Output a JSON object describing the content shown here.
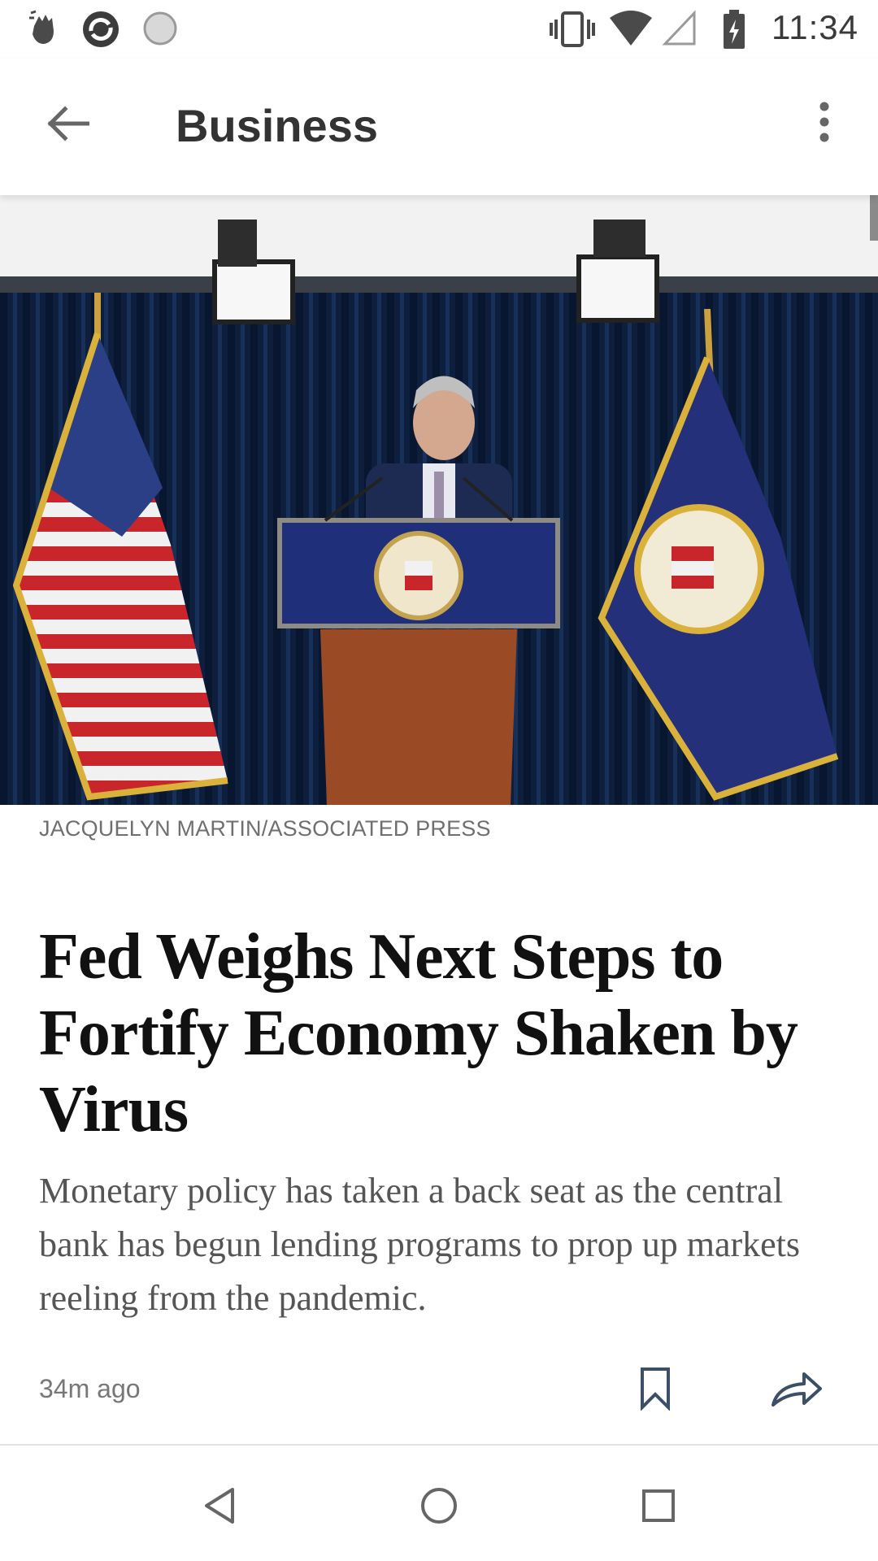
{
  "status_bar": {
    "time": "11:34",
    "left_icons": [
      "gesture-hand-icon",
      "sync-app-icon",
      "loading-circle-icon"
    ],
    "right_icons": [
      "vibrate-icon",
      "wifi-icon",
      "cell-signal-icon",
      "battery-charging-icon"
    ]
  },
  "app_bar": {
    "title": "Business",
    "back_icon": "arrow-back-icon",
    "menu_icon": "more-vert-icon"
  },
  "article": {
    "image_description_icon": "photo",
    "photo_credit": "JACQUELYN MARTIN/ASSOCIATED PRESS",
    "headline": "Fed Weighs Next Steps to Fortify Economy Shaken by Virus",
    "summary": "Monetary policy has taken a back seat as the central bank has begun lending programs to prop up markets reeling from the pandemic.",
    "timestamp": "34m ago",
    "bookmark_icon": "bookmark-icon",
    "share_icon": "share-icon"
  },
  "nav_bar": {
    "back_icon": "nav-back-icon",
    "home_icon": "nav-home-icon",
    "recents_icon": "nav-recents-icon"
  },
  "colors": {
    "accent_icon": "#3b4f66",
    "curtain": "#0d1f3d",
    "podium": "#1f2f7a",
    "podium_wood": "#9a4a25"
  }
}
